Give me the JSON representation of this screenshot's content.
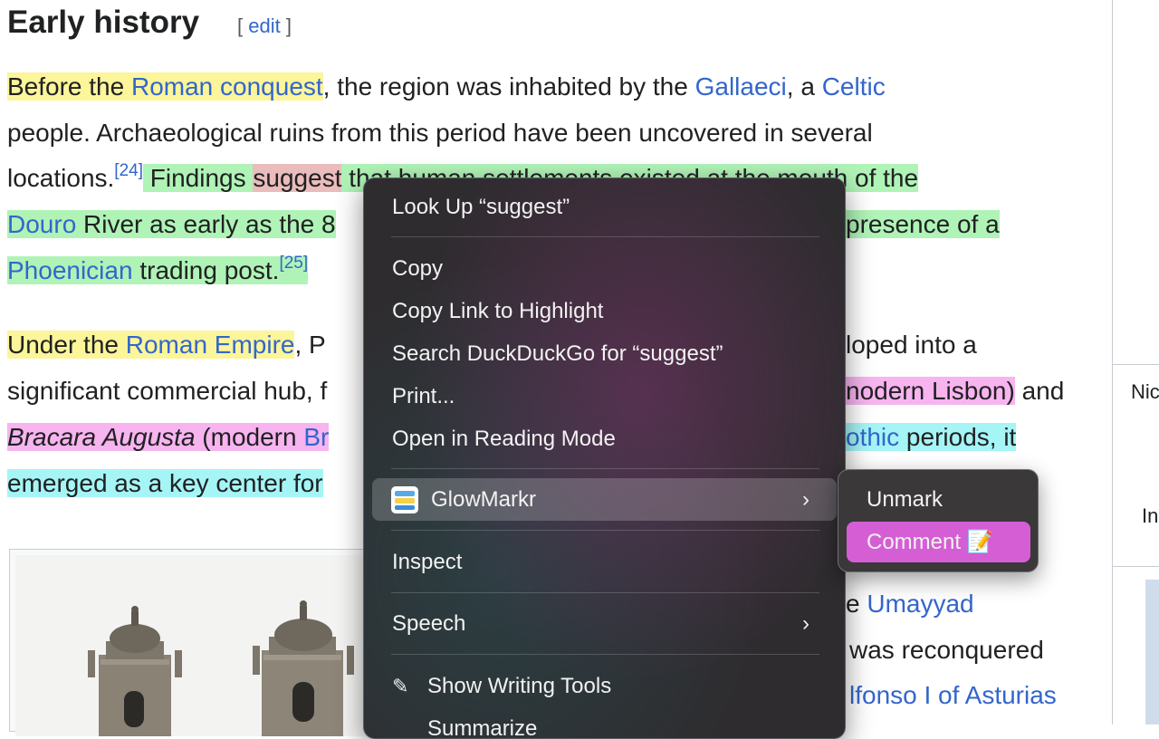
{
  "article": {
    "heading": "Early history",
    "edit_open": "[ ",
    "edit_label": "edit",
    "edit_close": " ]",
    "p1": {
      "l1_a": "Before the ",
      "l1_link1": "Roman conquest",
      "l1_b": ", the region was inhabited by the ",
      "l1_link2": "Gallaeci",
      "l1_c": ", a ",
      "l1_link3": "Celtic",
      "l2": "people. Archaeological ruins from this period have been uncovered in several",
      "l3_a": "locations.",
      "l3_ref": "[24]",
      "l3_b": " Findings ",
      "l3_sel": "suggest",
      "l3_c": " that human settlements existed at the mouth of the",
      "l4_link": "Douro",
      "l4_a": " River as early as the 8",
      "l4_b": "presence of a",
      "l5_link": "Phoenician",
      "l5_a": " trading post.",
      "l5_ref": "[25]"
    },
    "p2": {
      "l1_a": "Under the ",
      "l1_link": "Roman Empire",
      "l1_b": ", P",
      "l1_c": "loped into a",
      "l2_a": "significant commercial hub, f",
      "l2_b": "nodern Lisbon)",
      "l2_c": " and",
      "l3_a": "Bracara Augusta",
      "l3_b": " (modern ",
      "l3_link": "Br",
      "l3_c": "othic",
      "l3_d": " periods, it",
      "l4_a": "emerged as a key center for"
    },
    "p3": {
      "l1_a": "e ",
      "l1_link": "Umayyad",
      "l2": "was reconquered",
      "l3_link": "lfonso I of Asturias"
    }
  },
  "right_panel": {
    "text1": "Nic",
    "text2": "In"
  },
  "context_menu": {
    "look_up": "Look Up “suggest”",
    "copy": "Copy",
    "copy_link": "Copy Link to Highlight",
    "search": "Search DuckDuckGo for “suggest”",
    "print": "Print...",
    "reading_mode": "Open in Reading Mode",
    "glowmarkr": "GlowMarkr",
    "inspect": "Inspect",
    "speech": "Speech",
    "writing_tools": "Show Writing Tools",
    "summarize": "Summarize",
    "chevron": "›"
  },
  "submenu": {
    "unmark": "Unmark",
    "comment": "Comment",
    "comment_emoji": "📝"
  },
  "colors": {
    "highlight_yellow": "#fcf59a",
    "highlight_green": "#b0f3b7",
    "highlight_pink": "#f7b4ef",
    "highlight_cyan": "#a5f5f6",
    "link": "#3366cc",
    "submenu_active": "#d55ed4"
  }
}
